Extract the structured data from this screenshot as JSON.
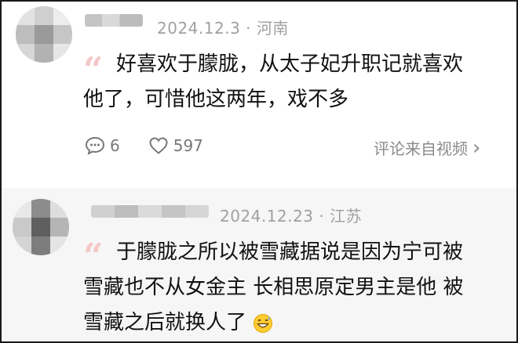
{
  "comments": [
    {
      "date": "2024.12.3",
      "separator": "·",
      "location": "河南",
      "quote": "“",
      "lines": [
        "好喜欢于朦胧，从太子妃升职记就喜欢",
        "他了，可惜他这两年，戏不多"
      ],
      "reply_count": "6",
      "like_count": "597",
      "source_label": "评论来自视频",
      "source_chevron": "›"
    },
    {
      "date": "2024.12.23",
      "separator": "·",
      "location": "江苏",
      "quote": "“",
      "lines": [
        "于朦胧之所以被雪藏据说是因为宁可被",
        "雪藏也不从女金主 长相思原定男主是他 被",
        "雪藏之后就换人了"
      ],
      "emoji": "grinning-sweat-emoji"
    }
  ],
  "colors": {
    "quote": "#f4c8c8",
    "meta": "#a0a0a0",
    "text": "#111111",
    "second_bg": "#f6f6f6"
  }
}
